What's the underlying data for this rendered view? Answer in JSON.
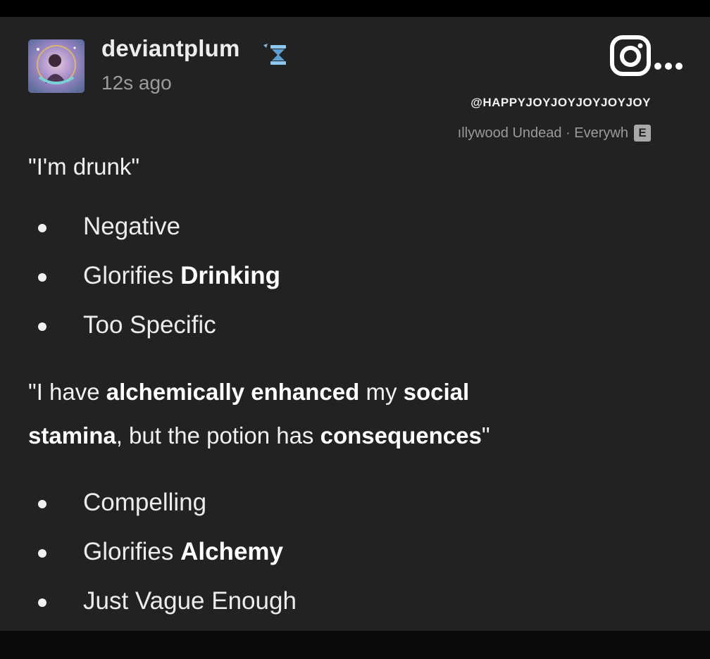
{
  "post": {
    "username": "deviantplum",
    "timestamp": "12s ago",
    "watermark_handle": "@HAPPYJOYJOYJOYJOYJOY",
    "music": {
      "text": "ıllywood Undead · Everywh",
      "explicit_label": "E"
    },
    "quote1": "\"I'm drunk\"",
    "list1": [
      {
        "plain": "Negative",
        "bold": ""
      },
      {
        "plain": "Glorifies ",
        "bold": "Drinking"
      },
      {
        "plain": "Too Specific",
        "bold": ""
      }
    ],
    "quote2": {
      "line1": [
        {
          "t": "\"I have ",
          "b": false
        },
        {
          "t": "alchemically enhanced",
          "b": true
        },
        {
          "t": " my ",
          "b": false
        },
        {
          "t": "social",
          "b": true
        }
      ],
      "line2": [
        {
          "t": "stamina",
          "b": true
        },
        {
          "t": ", but the potion has ",
          "b": false
        },
        {
          "t": "consequences",
          "b": true
        },
        {
          "t": "\"",
          "b": false
        }
      ]
    },
    "list2": [
      {
        "plain": "Compelling",
        "bold": ""
      },
      {
        "plain": "Glorifies ",
        "bold": "Alchemy"
      },
      {
        "plain": "Just Vague Enough",
        "bold": ""
      }
    ]
  },
  "icons": {
    "instagram": "instagram-icon",
    "more": "more-icon",
    "badge": "hourglass-badge-icon",
    "avatar": "avatar"
  },
  "colors": {
    "background": "#222222",
    "frame": "#000000",
    "text": "#ececec",
    "muted": "#9c9c9c"
  }
}
